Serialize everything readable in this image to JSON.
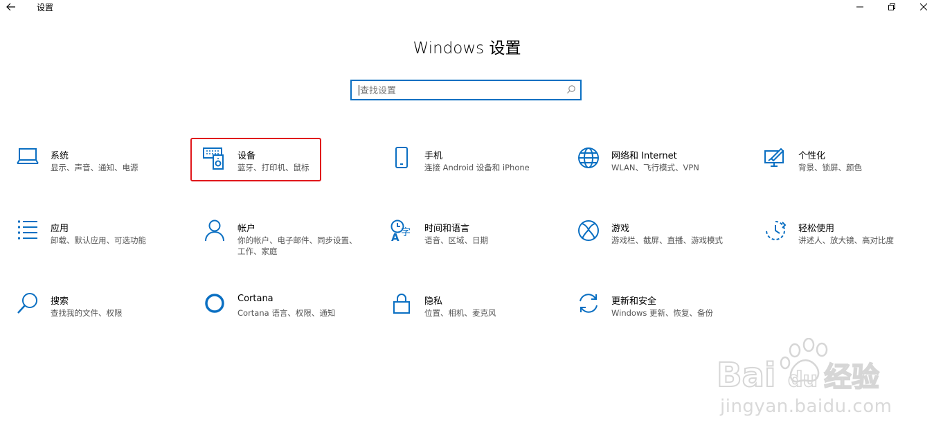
{
  "window": {
    "app_title": "设置",
    "back_glyph": "←",
    "minimize_glyph": "—",
    "close_glyph": "✕"
  },
  "page_title": "Windows 设置",
  "search": {
    "placeholder": "查找设置"
  },
  "accent_color": "#0a6fc2",
  "highlight_color": "#e0161a",
  "tiles": [
    {
      "name": "系统",
      "desc": "显示、声音、通知、电源",
      "icon": "laptop-icon"
    },
    {
      "name": "设备",
      "desc": "蓝牙、打印机、鼠标",
      "icon": "devices-icon"
    },
    {
      "name": "手机",
      "desc": "连接 Android 设备和 iPhone",
      "icon": "phone-icon"
    },
    {
      "name": "网络和 Internet",
      "desc": "WLAN、飞行模式、VPN",
      "icon": "globe-icon"
    },
    {
      "name": "个性化",
      "desc": "背景、锁屏、颜色",
      "icon": "personalization-icon"
    },
    {
      "name": "应用",
      "desc": "卸载、默认应用、可选功能",
      "icon": "apps-list-icon"
    },
    {
      "name": "帐户",
      "desc": "你的帐户、电子邮件、同步设置、工作、家庭",
      "icon": "person-icon"
    },
    {
      "name": "时间和语言",
      "desc": "语音、区域、日期",
      "icon": "time-language-icon"
    },
    {
      "name": "游戏",
      "desc": "游戏栏、截屏、直播、游戏模式",
      "icon": "xbox-icon"
    },
    {
      "name": "轻松使用",
      "desc": "讲述人、放大镜、高对比度",
      "icon": "ease-of-access-icon"
    },
    {
      "name": "搜索",
      "desc": "查找我的文件、权限",
      "icon": "search-magnifier-icon"
    },
    {
      "name": "Cortana",
      "desc": "Cortana 语言、权限、通知",
      "icon": "cortana-icon"
    },
    {
      "name": "隐私",
      "desc": "位置、相机、麦克风",
      "icon": "lock-icon"
    },
    {
      "name": "更新和安全",
      "desc": "Windows 更新、恢复、备份",
      "icon": "update-icon"
    }
  ],
  "watermark": {
    "logo_text": "Bai du 经验",
    "url": "jingyan.baidu.com"
  }
}
